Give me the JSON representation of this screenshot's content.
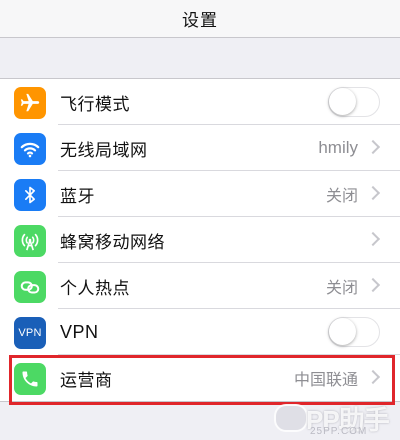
{
  "nav": {
    "title": "设置"
  },
  "rows": [
    {
      "label": "飞行模式",
      "icon": "airplane-icon",
      "color": "#ff9500",
      "accessory": "toggle",
      "toggle_on": false
    },
    {
      "label": "无线局域网",
      "icon": "wifi-icon",
      "color": "#1a7cf5",
      "accessory": "chevron",
      "value": "hmily"
    },
    {
      "label": "蓝牙",
      "icon": "bluetooth-icon",
      "color": "#1a7cf5",
      "accessory": "chevron",
      "value": "关闭"
    },
    {
      "label": "蜂窝移动网络",
      "icon": "cellular-icon",
      "color": "#4cd964",
      "accessory": "chevron"
    },
    {
      "label": "个人热点",
      "icon": "hotspot-icon",
      "color": "#4cd964",
      "accessory": "chevron",
      "value": "关闭"
    },
    {
      "label": "VPN",
      "icon": "vpn-icon",
      "icon_text": "VPN",
      "color": "#1a5fb8",
      "accessory": "toggle",
      "toggle_on": false
    },
    {
      "label": "运营商",
      "icon": "phone-icon",
      "color": "#4cd964",
      "accessory": "chevron",
      "value": "中国联通"
    }
  ],
  "highlight_color": "#e0262b",
  "watermark": {
    "text": "PP助手",
    "sub": "25PP.COM"
  }
}
